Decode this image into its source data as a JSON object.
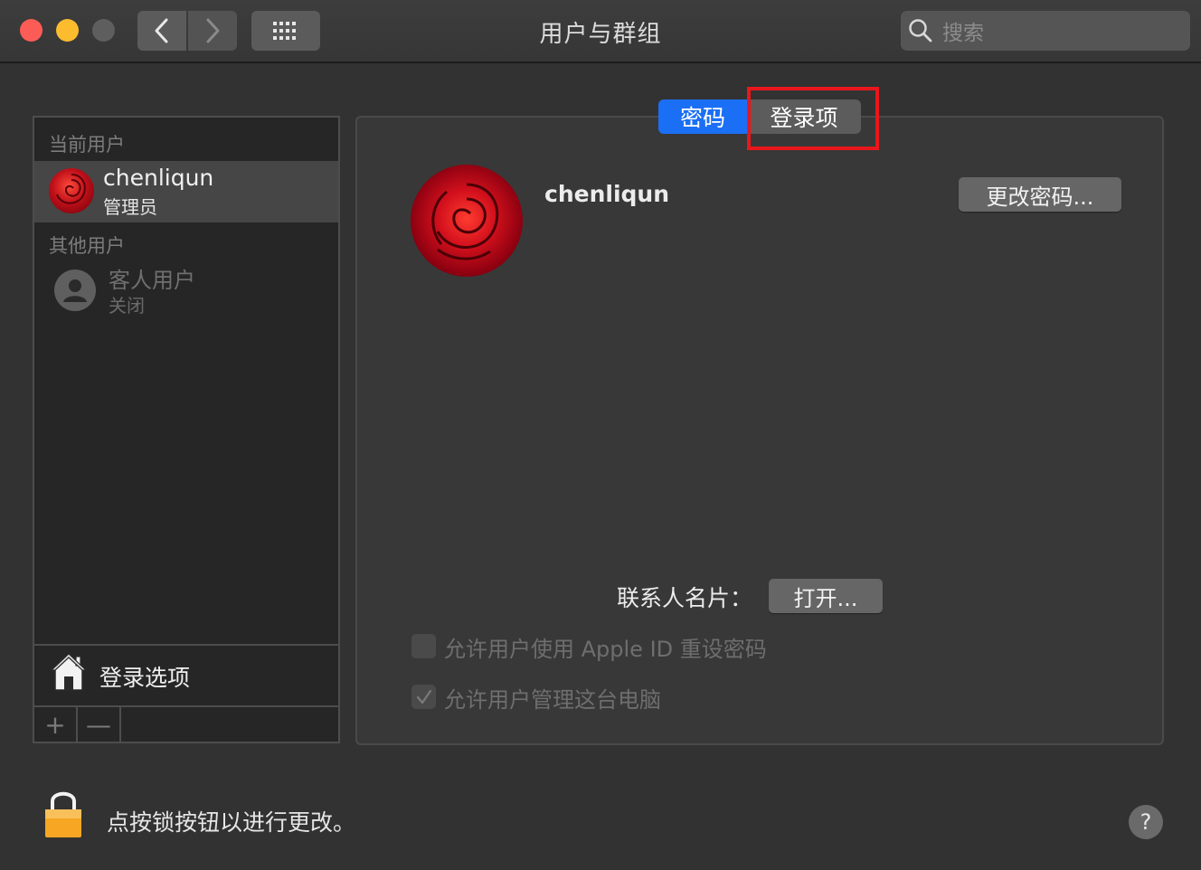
{
  "window": {
    "title": "用户与群组",
    "search_placeholder": "搜索"
  },
  "sidebar": {
    "current_section_label": "当前用户",
    "current_user": {
      "name": "chenliqun",
      "role": "管理员"
    },
    "other_section_label": "其他用户",
    "guest_user": {
      "name": "客人用户",
      "status": "关闭"
    },
    "login_options_label": "登录选项",
    "add_button": "+",
    "remove_button": "—"
  },
  "tabs": [
    {
      "label": "密码",
      "selected": true
    },
    {
      "label": "登录项",
      "selected": false
    }
  ],
  "main": {
    "user_name": "chenliqun",
    "change_password_button": "更改密码...",
    "contact_card_label": "联系人名片：",
    "open_button": "打开...",
    "checkboxes": [
      {
        "label": "允许用户使用 Apple ID 重设密码",
        "checked": false,
        "enabled": false
      },
      {
        "label": "允许用户管理这台电脑",
        "checked": true,
        "enabled": false
      }
    ]
  },
  "footer": {
    "lock_text": "点按锁按钮以进行更改。",
    "help_label": "?"
  },
  "colors": {
    "accent": "#1b6ff5",
    "highlight": "#e8171c",
    "background": "#323232"
  },
  "icons": [
    "close",
    "minimize",
    "zoom",
    "chevron-left-icon",
    "chevron-right-icon",
    "grid-icon",
    "search-icon",
    "house-icon",
    "lock-icon",
    "person-icon",
    "checkmark-icon"
  ]
}
